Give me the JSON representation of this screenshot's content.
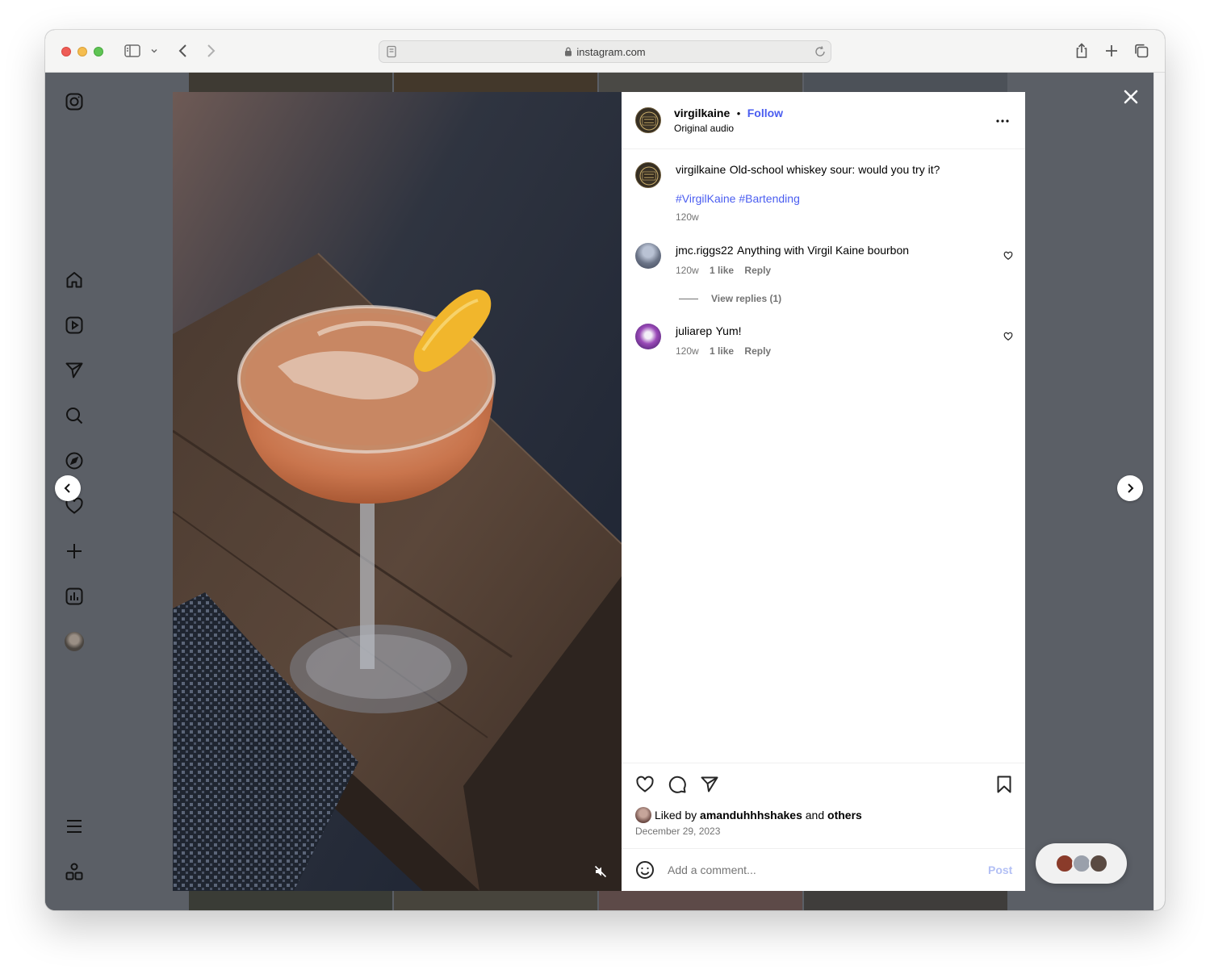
{
  "browser": {
    "url": "instagram.com"
  },
  "post": {
    "username": "virgilkaine",
    "separator": "•",
    "follow_label": "Follow",
    "audio": "Original audio",
    "caption_user": "virgilkaine",
    "caption_text": "Old-school whiskey sour: would you try it?",
    "hashtags": "#VirgilKaine #Bartending",
    "caption_time": "120w",
    "more_label": "..."
  },
  "comments": [
    {
      "user": "jmc.riggs22",
      "text": "Anything with Virgil Kaine bourbon",
      "time": "120w",
      "likes": "1 like",
      "reply": "Reply",
      "view_replies": "View replies (1)"
    },
    {
      "user": "juliarep",
      "text": "Yum!",
      "time": "120w",
      "likes": "1 like",
      "reply": "Reply"
    }
  ],
  "likes": {
    "prefix": "Liked by",
    "user": "amanduhhhshakes",
    "middle": "and",
    "others": "others",
    "date": "December 29, 2023"
  },
  "comment_input": {
    "placeholder": "Add a comment...",
    "post_label": "Post"
  },
  "colors": {
    "accent": "#4a5df0",
    "overlay": "#5b5f66"
  },
  "icons": {
    "nav": [
      "instagram-icon",
      "home-icon",
      "reels-icon",
      "messages-icon",
      "search-icon",
      "explore-icon",
      "notifications-icon",
      "create-icon",
      "insights-icon",
      "menu-icon",
      "apps-icon"
    ]
  }
}
